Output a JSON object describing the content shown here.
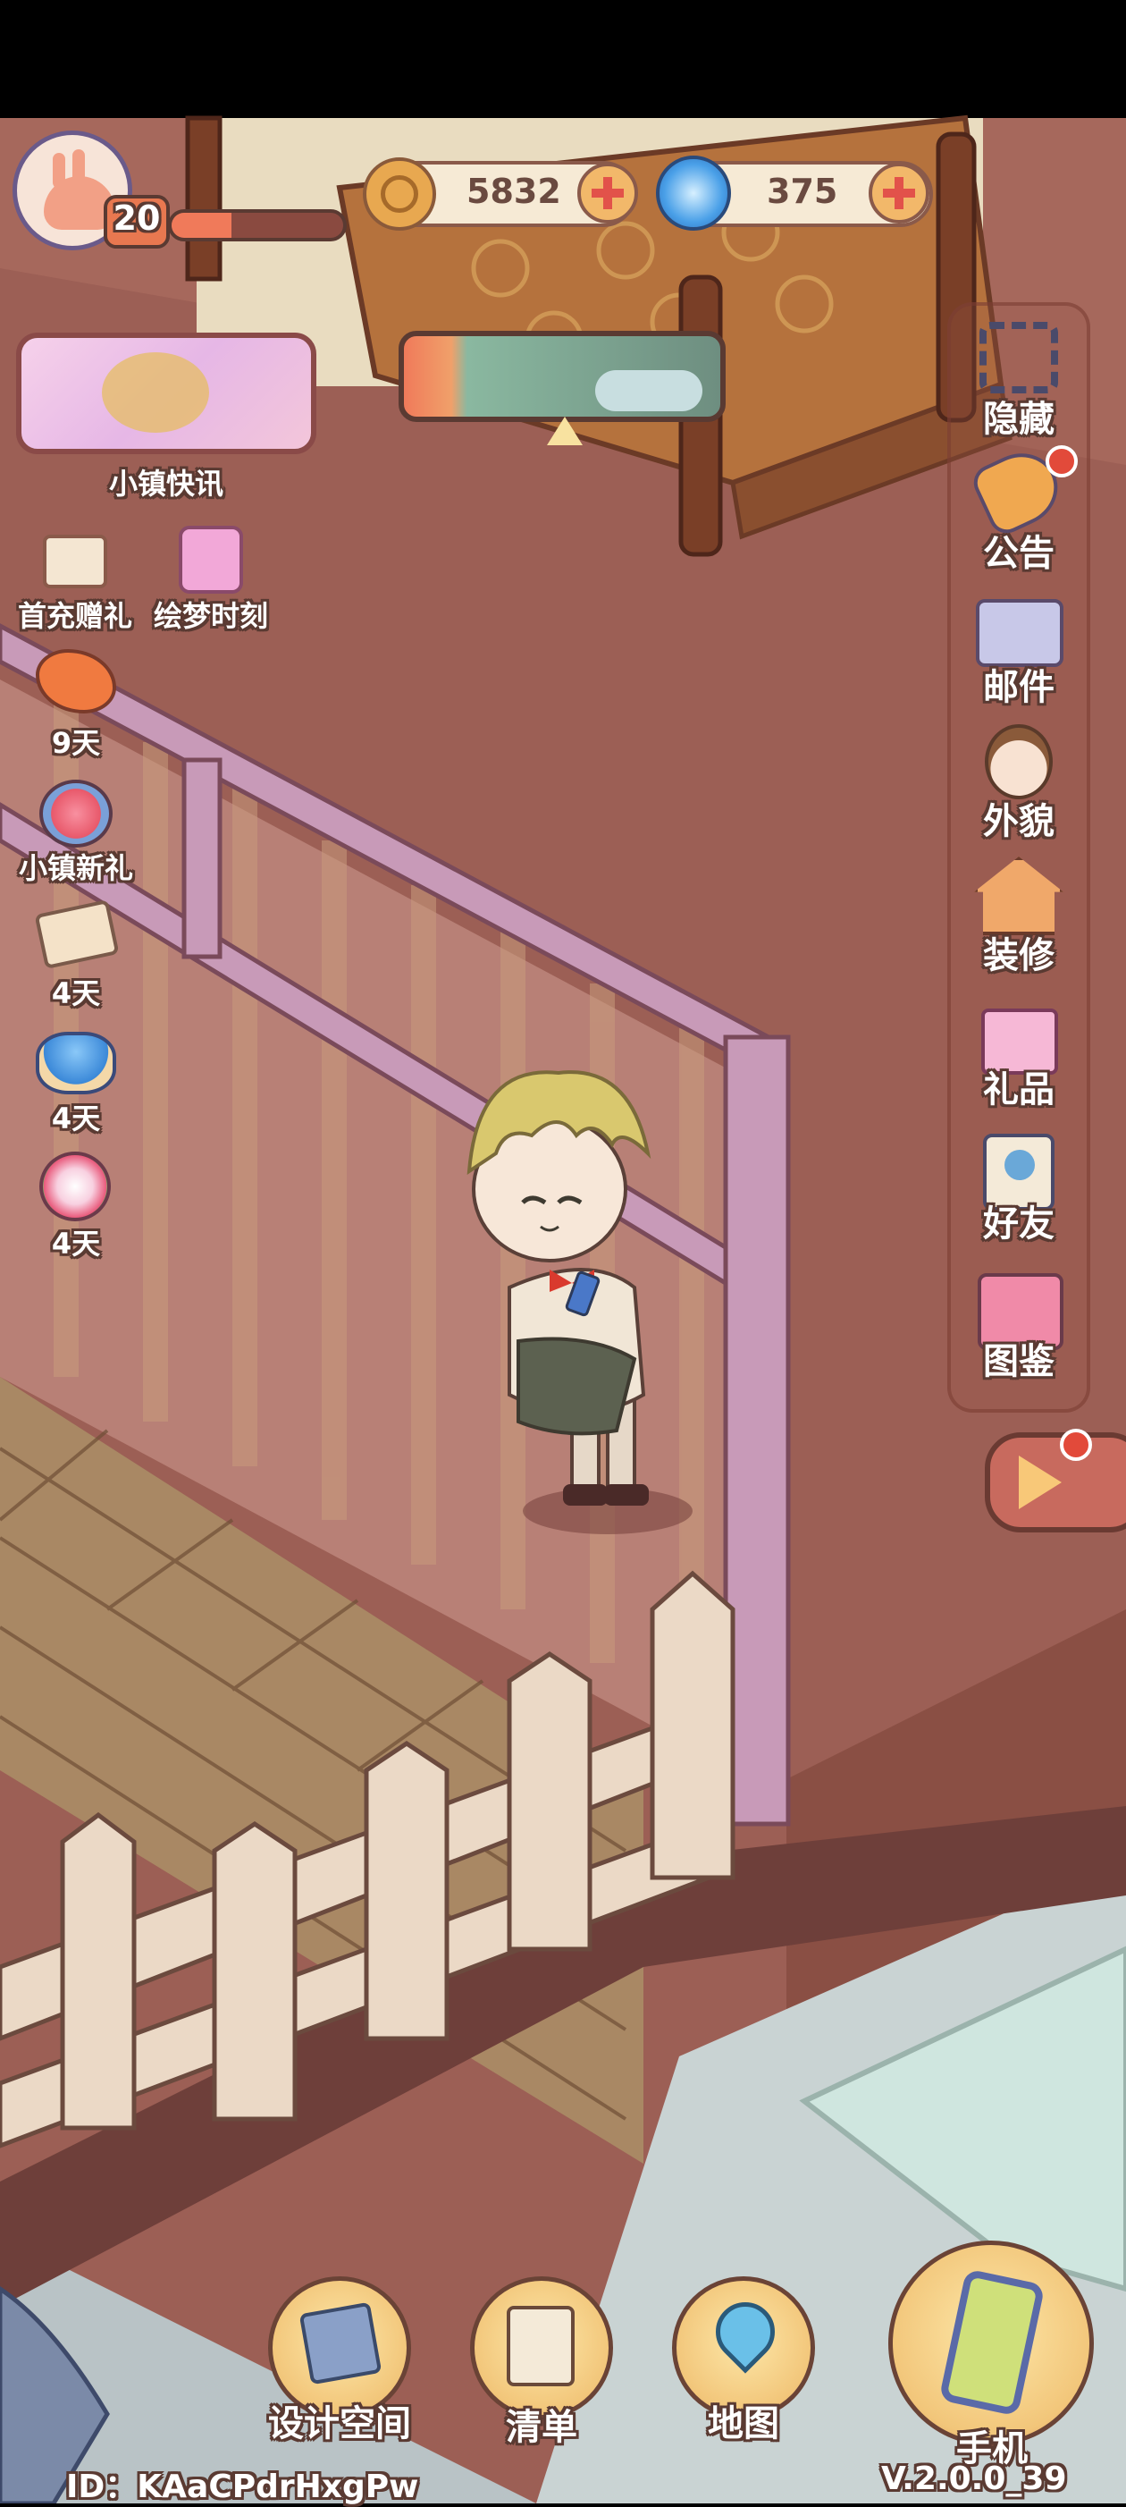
{
  "player": {
    "level": "20",
    "avatar_icon": "snail-avatar-icon"
  },
  "currencies": [
    {
      "icon": "gold-coin-icon",
      "value": "5832"
    },
    {
      "icon": "blue-swirl-gem-icon",
      "value": "375"
    }
  ],
  "top_banner": {
    "label": "小镇快讯"
  },
  "left_events": [
    {
      "label": "首充赠礼",
      "icon": "gift-book-icon"
    },
    {
      "label": "绘梦时刻",
      "icon": "pink-bow-gift-icon"
    },
    {
      "label": "9天",
      "icon": "phoenix-event-icon"
    },
    {
      "label": "小镇新礼",
      "icon": "rose-envelope-icon"
    },
    {
      "label": "4天",
      "icon": "letter-wax-seal-icon"
    },
    {
      "label": "4天",
      "icon": "blue-flower-cake-icon"
    },
    {
      "label": "4天",
      "icon": "flower-bouquet-icon"
    }
  ],
  "right_menu": [
    {
      "label": "隐藏",
      "icon": "hide-frame-icon",
      "badge": false
    },
    {
      "label": "公告",
      "icon": "megaphone-icon",
      "badge": true
    },
    {
      "label": "邮件",
      "icon": "mail-envelope-icon",
      "badge": false
    },
    {
      "label": "外貌",
      "icon": "character-face-icon",
      "badge": false
    },
    {
      "label": "装修",
      "icon": "house-wrench-icon",
      "badge": false
    },
    {
      "label": "礼品",
      "icon": "gift-box-icon",
      "badge": false
    },
    {
      "label": "好友",
      "icon": "friend-notebook-icon",
      "badge": false
    },
    {
      "label": "图鉴",
      "icon": "collection-book-icon",
      "badge": false
    }
  ],
  "play_button": {
    "icon": "play-arrow-icon",
    "badge": true
  },
  "bottom_bar": [
    {
      "label": "设计空间",
      "icon": "design-ruler-icon"
    },
    {
      "label": "清单",
      "icon": "checklist-quill-icon"
    },
    {
      "label": "地图",
      "icon": "map-pin-icon"
    },
    {
      "label": "手机",
      "icon": "mobile-phone-icon"
    }
  ],
  "footer": {
    "id_text": "ID：KAaCPdrHxgPw",
    "version": "V.2.0.0_39"
  },
  "colors": {
    "floor": "#9c5f55",
    "plus_red": "#e2524a",
    "label_outline": "#5a3a32"
  }
}
